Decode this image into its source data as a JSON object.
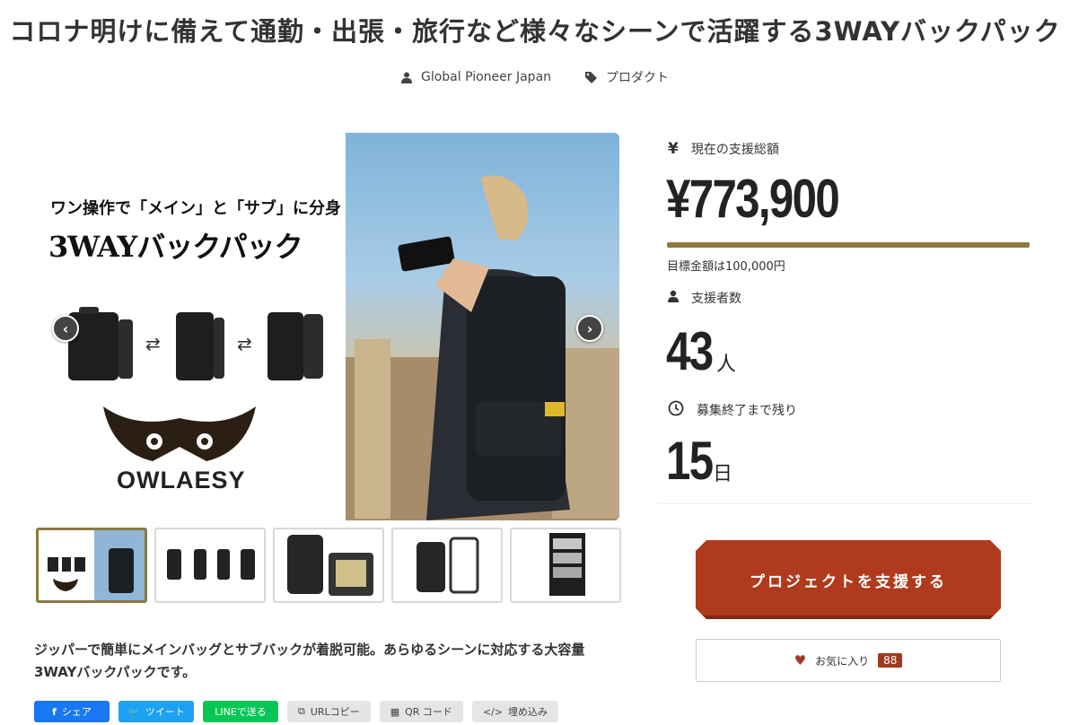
{
  "page": {
    "title": "コロナ明けに備えて通勤・出張・旅行など様々なシーンで活躍する3WAYバックパック",
    "owner": "Global Pioneer Japan",
    "category": "プロダクト"
  },
  "gallery": {
    "headline_1": "ワン操作で「メイン」と「サブ」に分身",
    "headline_2": "3WAYバックパック",
    "brand": "OWLAESY",
    "thumb_count": 5,
    "active_thumb": 1
  },
  "description": "ジッパーで簡単にメインバッグとサブバックが着脱可能。あらゆるシーンに対応する大容量3WAYバックパックです。",
  "share": {
    "facebook": "シェア",
    "twitter": "ツイート",
    "line": "LINEで送る",
    "url_copy": "URLコピー",
    "qr": "QR コード",
    "embed": "埋め込み"
  },
  "funding": {
    "amount_label": "現在の支援総額",
    "amount": "¥773,900",
    "goal_text": "目標金額は100,000円",
    "progress_fraction": 1.0,
    "supporters_label": "支援者数",
    "supporters": "43",
    "supporters_unit": "人",
    "remaining_label": "募集終了まで残り",
    "remaining": "15",
    "remaining_unit": "日",
    "accent_color": "#8c7a3d"
  },
  "actions": {
    "support_label": "プロジェクトを支援する",
    "support_color": "#b03a1e",
    "favorite_label": "お気に入り",
    "favorite_count": "88"
  }
}
